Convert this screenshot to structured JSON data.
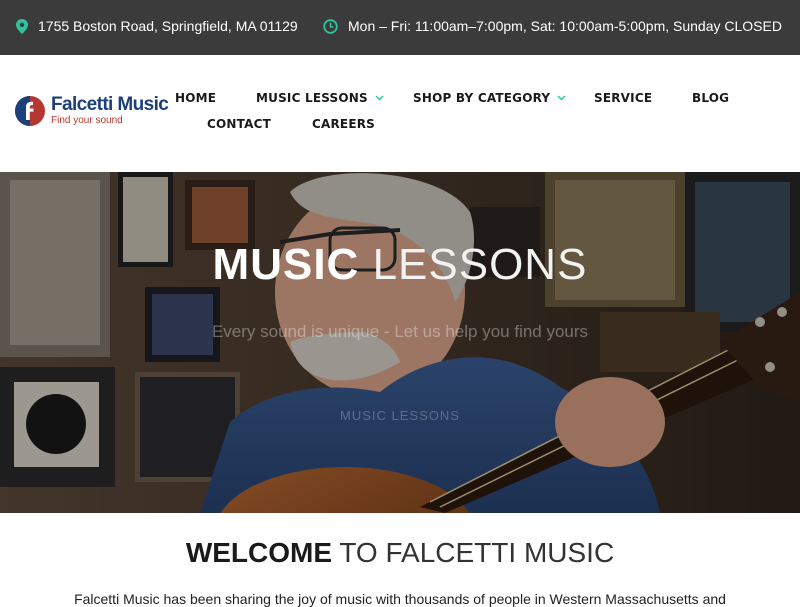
{
  "topbar": {
    "address": "1755 Boston Road, Springfield, MA 01129",
    "address_icon": "map-pin-icon",
    "hours": "Mon – Fri: 11:00am–7:00pm, Sat: 10:00am-5:00pm, Sunday CLOSED",
    "hours_icon": "clock-icon",
    "icon_color": "#2ec4a0"
  },
  "logo": {
    "name": "Falcetti Music",
    "tagline": "Find your sound",
    "mark_color": "#b5372f"
  },
  "nav": {
    "home": "HOME",
    "music_lessons": "MUSIC LESSONS",
    "shop_by_category": "SHOP BY CATEGORY",
    "service": "SERVICE",
    "blog": "BLOG",
    "contact": "CONTACT",
    "careers": "CAREERS",
    "chevron_color": "#2ec4a0"
  },
  "hero": {
    "title_bold": "MUSIC",
    "title_light": "LESSONS",
    "subtitle": "Every sound is unique - Let us help you find yours",
    "button_label": "MUSIC LESSONS"
  },
  "welcome": {
    "title_bold": "WELCOME",
    "title_light": "TO FALCETTI MUSIC",
    "intro": "Falcetti Music has been sharing the joy of music with thousands of people in Western Massachusetts and"
  }
}
